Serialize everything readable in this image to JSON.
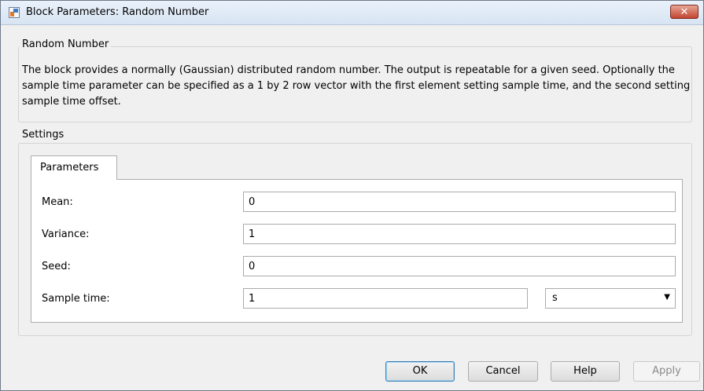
{
  "window": {
    "title": "Block Parameters: Random Number",
    "close_label": "✕"
  },
  "block_group": {
    "title": "Random Number",
    "description": "The block provides a normally (Gaussian) distributed random number. The output is repeatable for a given seed. Optionally the sample time parameter can be specified as a 1 by 2 row vector with the first element setting sample time, and the second setting sample time offset."
  },
  "settings_group": {
    "title": "Settings",
    "tabs": [
      {
        "label": "Parameters"
      }
    ],
    "fields": [
      {
        "label": "Mean:",
        "value": "0"
      },
      {
        "label": "Variance:",
        "value": "1"
      },
      {
        "label": "Seed:",
        "value": "0"
      },
      {
        "label": "Sample time:",
        "value": "1"
      }
    ],
    "unit_select": {
      "value": "s",
      "arrow": "▼"
    }
  },
  "buttons": {
    "ok": "OK",
    "cancel": "Cancel",
    "help": "Help",
    "apply": "Apply"
  }
}
